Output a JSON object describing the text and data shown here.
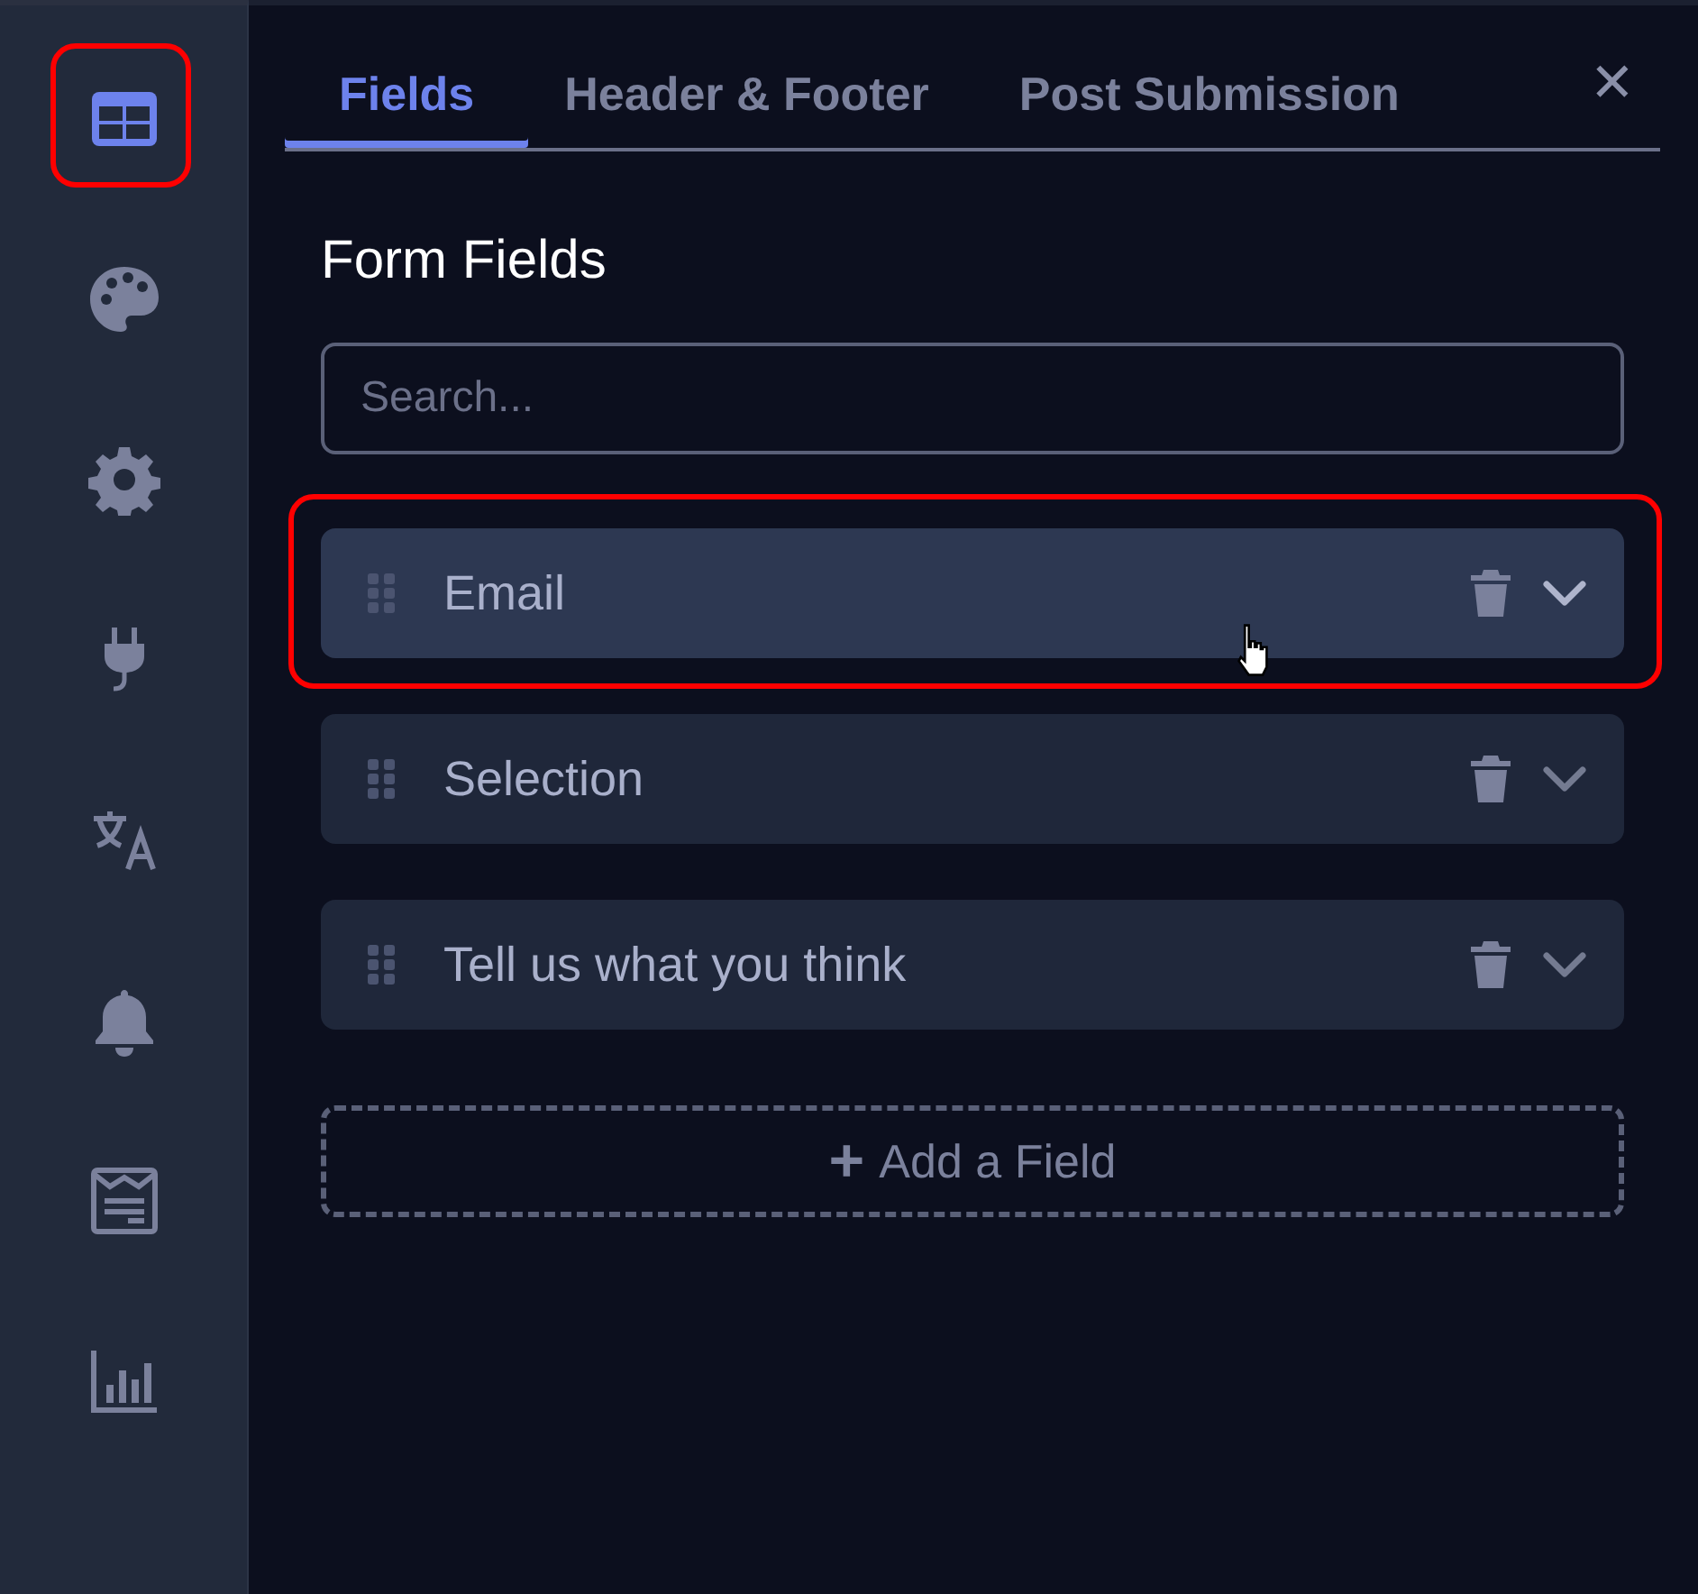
{
  "sidebar": {
    "items": [
      {
        "kind": "table",
        "selected": true,
        "annotated": true
      },
      {
        "kind": "palette",
        "selected": false,
        "annotated": false
      },
      {
        "kind": "gear",
        "selected": false,
        "annotated": false
      },
      {
        "kind": "plug",
        "selected": false,
        "annotated": false
      },
      {
        "kind": "translate",
        "selected": false,
        "annotated": false
      },
      {
        "kind": "bell",
        "selected": false,
        "annotated": false
      },
      {
        "kind": "form",
        "selected": false,
        "annotated": false
      },
      {
        "kind": "chart",
        "selected": false,
        "annotated": false
      }
    ]
  },
  "tabs": [
    {
      "label": "Fields",
      "selected": true
    },
    {
      "label": "Header & Footer",
      "selected": false
    },
    {
      "label": "Post Submission",
      "selected": false
    }
  ],
  "close": "✕",
  "title": "Form Fields",
  "search": {
    "placeholder": "Search..."
  },
  "fields": [
    {
      "label": "Email",
      "hovered": true,
      "annotated": true
    },
    {
      "label": "Selection",
      "hovered": false,
      "annotated": false
    },
    {
      "label": "Tell us what you think",
      "hovered": false,
      "annotated": false
    }
  ],
  "add_button": {
    "icon": "+",
    "label": "Add a Field"
  }
}
